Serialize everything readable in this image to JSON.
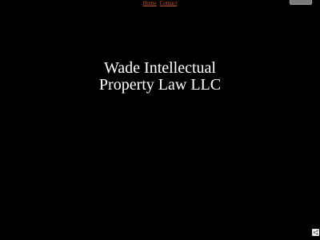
{
  "nav": {
    "items": [
      {
        "label": "Home"
      },
      {
        "label": "Contact"
      }
    ],
    "link_color": "#c9582c"
  },
  "page": {
    "background": "#000000",
    "title_line1": "Wade Intellectual",
    "title_line2": "Property Law LLC"
  },
  "icons": {
    "corner_button": "window-control-icon",
    "badge": "share-icon"
  }
}
